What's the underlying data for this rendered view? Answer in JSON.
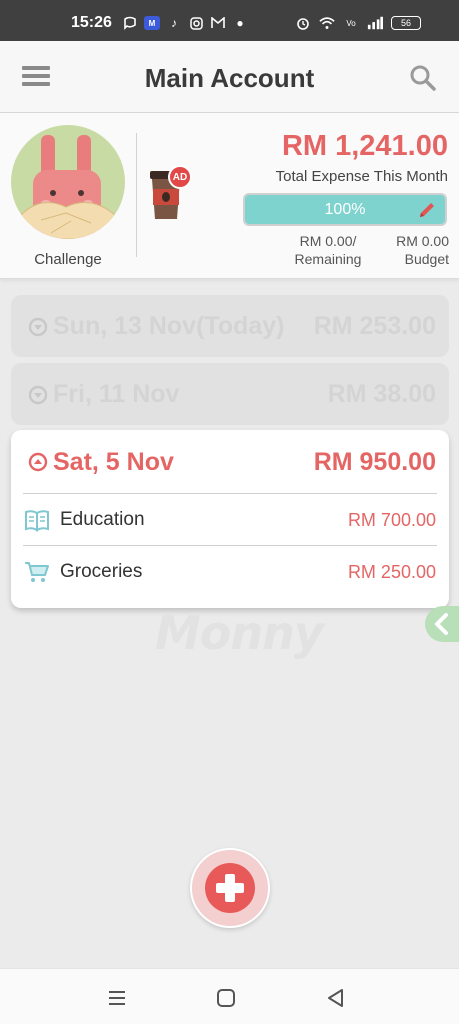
{
  "status_bar": {
    "time": "15:26",
    "battery": "56",
    "icons_left": [
      "chat-bubble-icon",
      "app-tag-icon",
      "tiktok-icon",
      "instagram-icon",
      "mail-icon",
      "dot-icon"
    ],
    "icons_right": [
      "alarm-icon",
      "wifi-icon",
      "volte-icon",
      "signal-icon",
      "battery-icon"
    ]
  },
  "header": {
    "title": "Main Account",
    "menu_icon": "hamburger-menu-icon",
    "search_icon": "search-icon"
  },
  "summary": {
    "challenge_label": "Challenge",
    "ad_badge": "AD",
    "total_amount": "RM 1,241.00",
    "total_label": "Total Expense This Month",
    "progress_text": "100%",
    "progress_fraction": 1.0,
    "remaining_line1": "RM 0.00/",
    "remaining_line2": "Remaining",
    "budget_line1": "RM 0.00",
    "budget_line2": "Budget"
  },
  "groups": [
    {
      "date": "Sun, 13 Nov(Today)",
      "amount": "RM 253.00",
      "expanded": false
    },
    {
      "date": "Fri, 11 Nov",
      "amount": "RM 38.00",
      "expanded": false
    },
    {
      "date": "Sat, 5 Nov",
      "amount": "RM 950.00",
      "expanded": true,
      "items": [
        {
          "category": "Education",
          "amount": "RM 700.00",
          "icon": "book-icon"
        },
        {
          "category": "Groceries",
          "amount": "RM 250.00",
          "icon": "shopping-cart-icon"
        }
      ]
    }
  ],
  "watermark": "Monny",
  "colors": {
    "accent": "#e56565",
    "progress": "#7fd3ce",
    "icon_teal": "#7fc7d1",
    "fab": "#e85a5a"
  }
}
